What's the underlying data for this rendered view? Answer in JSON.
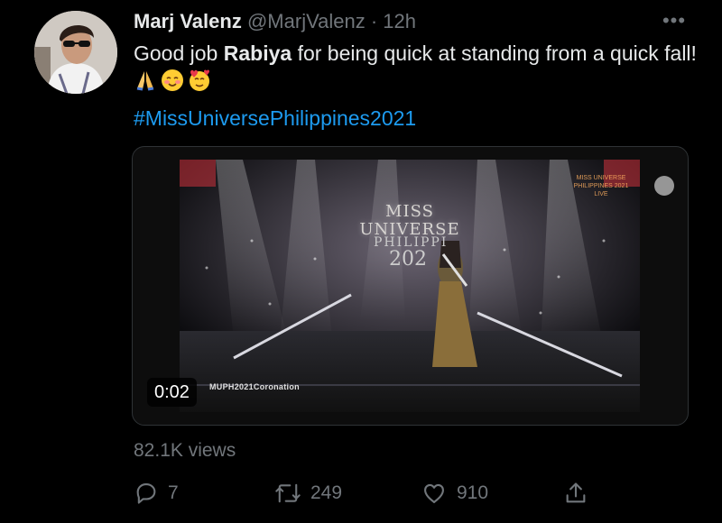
{
  "tweet": {
    "author_name": "Marj Valenz",
    "author_handle": "@MarjValenz",
    "separator": "·",
    "time": "12h",
    "more_label": "•••",
    "text_part1": "Good job ",
    "text_bold": "Rabiya",
    "text_part2": " for being quick at standing from a quick fall!",
    "hashtag": "#MissUniversePhilippines2021",
    "views": "82.1K views"
  },
  "media": {
    "timestamp": "0:02",
    "overlay_title": "MISS UNIVERSE",
    "overlay_sub": "PHILIPPI",
    "overlay_year": "202",
    "watermark": "MUPH2021Coronation",
    "corner_logo": "MISS UNIVERSE PHILIPPINES 2021 LIVE"
  },
  "actions": {
    "replies": "7",
    "retweets": "249",
    "likes": "910"
  },
  "colors": {
    "background": "#000000",
    "text": "#e7e9ea",
    "muted": "#71767b",
    "link": "#1d9bf0"
  },
  "icons": [
    "avatar",
    "more-icon",
    "folded-hands-emoji",
    "smiling-blush-emoji",
    "hearts-face-emoji",
    "reply-icon",
    "retweet-icon",
    "like-icon",
    "share-icon"
  ]
}
